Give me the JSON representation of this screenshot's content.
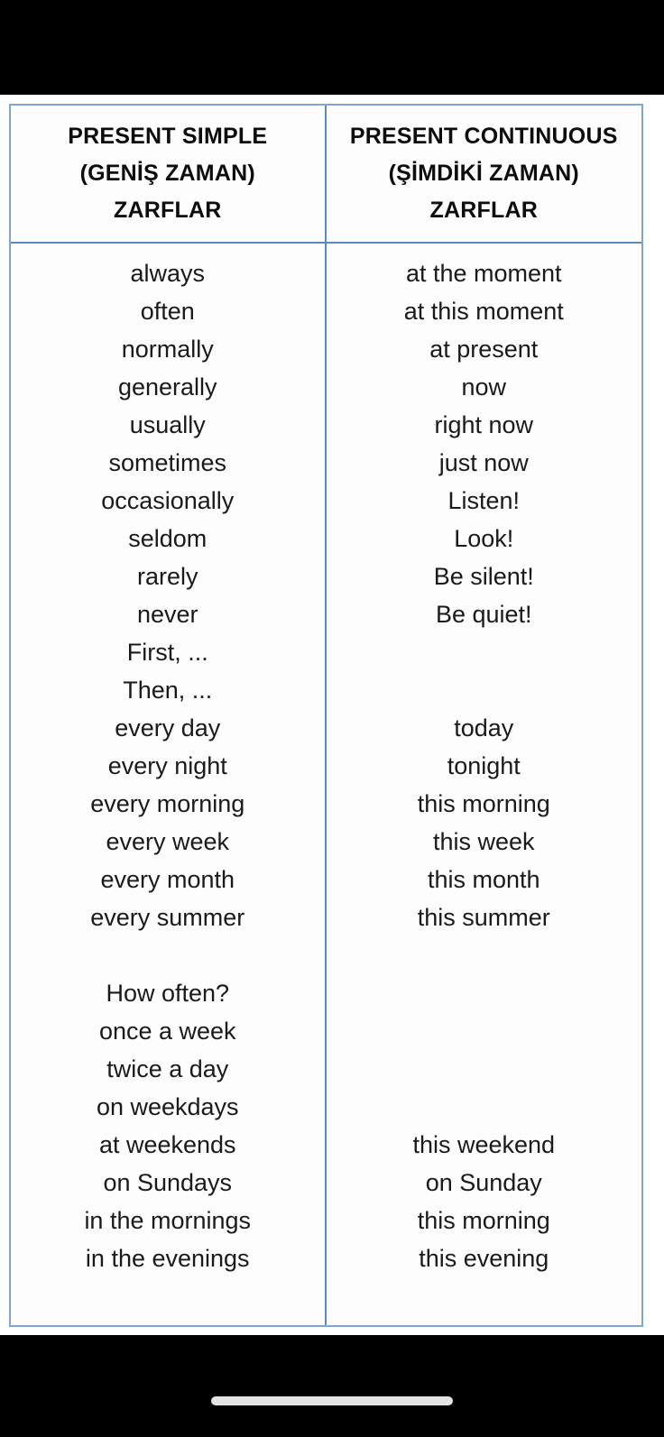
{
  "table": {
    "columns": [
      {
        "id": "present-simple",
        "header_lines": [
          "PRESENT SIMPLE",
          "(GENİŞ ZAMAN)",
          "ZARFLAR"
        ],
        "entries": [
          "always",
          "often",
          "normally",
          "generally",
          "usually",
          "sometimes",
          "occasionally",
          "seldom",
          "rarely",
          "never",
          "First, ...",
          "Then, ...",
          "every day",
          "every night",
          "every morning",
          "every week",
          "every month",
          "every summer",
          "",
          "How often?",
          "once a week",
          "twice a day",
          "on weekdays",
          "at weekends",
          "on Sundays",
          "in the mornings",
          "in the evenings"
        ]
      },
      {
        "id": "present-continuous",
        "header_lines": [
          "PRESENT CONTINUOUS",
          "(ŞİMDİKİ ZAMAN)",
          "ZARFLAR"
        ],
        "entries": [
          "at the moment",
          "at this moment",
          "at present",
          "now",
          "right now",
          "just now",
          "Listen!",
          "Look!",
          "Be silent!",
          "Be quiet!",
          "",
          "",
          "today",
          "tonight",
          "this morning",
          "this week",
          "this month",
          "this summer",
          "",
          "",
          "",
          "",
          "",
          "this weekend",
          "on Sunday",
          "this morning",
          "this evening"
        ]
      }
    ]
  },
  "colors": {
    "table_border": "#7da7d0",
    "table_divider": "#5b89bb",
    "page_background": "#ffffff",
    "device_background": "#000000",
    "text": "#1a1a1a",
    "home_indicator": "#e4e4e4"
  }
}
